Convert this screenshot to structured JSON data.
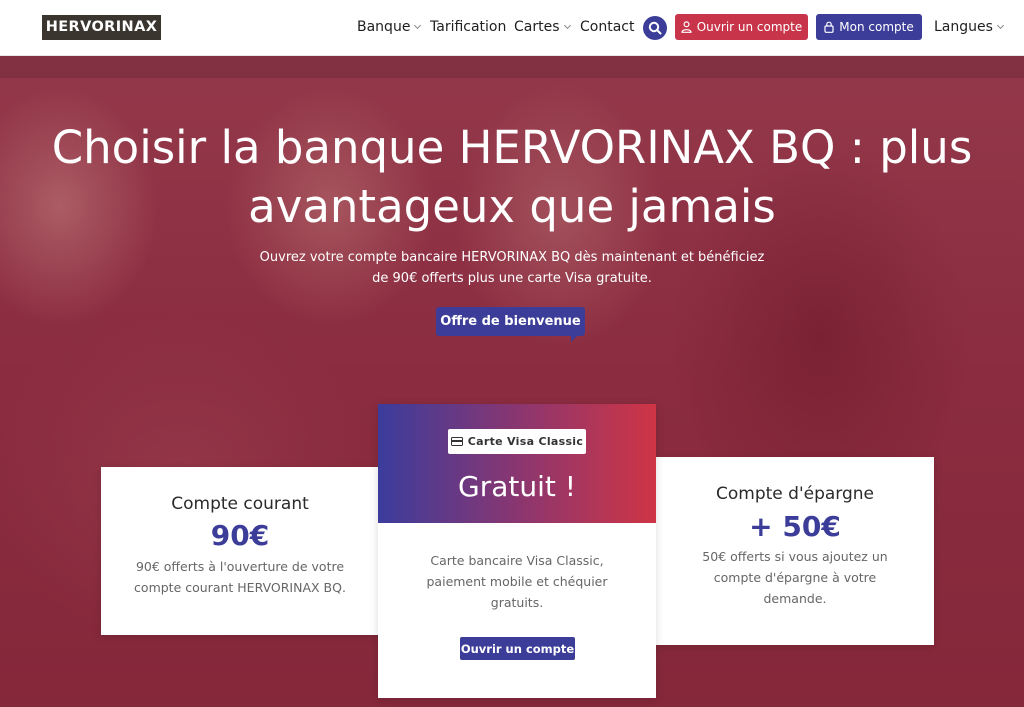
{
  "brand": {
    "logo": "HERVORINAX"
  },
  "nav": {
    "items": [
      {
        "label": "Banque",
        "dropdown": true
      },
      {
        "label": "Tarification",
        "dropdown": false
      },
      {
        "label": "Cartes",
        "dropdown": true
      },
      {
        "label": "Contact",
        "dropdown": false
      }
    ],
    "search_icon": "search-icon",
    "open_account": "Ouvrir un compte",
    "my_account": "Mon compte",
    "languages": "Langues"
  },
  "hero": {
    "title": "Choisir la banque HERVORINAX BQ : plus avantageux que jamais",
    "subtitle": "Ouvrez votre compte bancaire HERVORINAX BQ dès maintenant et bénéficiez de 90€ offerts plus une carte Visa gratuite.",
    "cta": "Offre de bienvenue"
  },
  "cards": {
    "left": {
      "title": "Compte courant",
      "amount": "90€",
      "description": "90€ offerts à l'ouverture de votre compte courant HERVORINAX BQ."
    },
    "center": {
      "badge": "Carte Visa Classic",
      "headline": "Gratuit !",
      "description": "Carte bancaire Visa Classic, paiement mobile et chéquier gratuits.",
      "button": "Ouvrir un compte"
    },
    "right": {
      "title": "Compte d'épargne",
      "amount": "+ 50€",
      "description": "50€ offerts si vous ajoutez un compte d'épargne à votre demande."
    }
  },
  "colors": {
    "primary": "#3c3d99",
    "accent": "#c8354b",
    "hero_overlay": "#8a2a3c",
    "logo_bg": "#3a352f"
  }
}
